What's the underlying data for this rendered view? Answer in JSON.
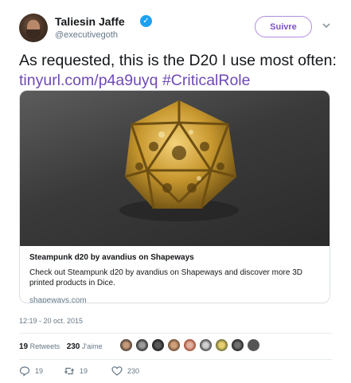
{
  "tweet": {
    "author_name": "Taliesin Jaffe",
    "handle": "@executivegoth",
    "follow_label": "Suivre",
    "text": "As requested, this is the D20 I use most often:",
    "link": "tinyurl.com/p4a9uyq",
    "hashtag": "#CriticalRole",
    "timestamp": "12:19 - 20 oct. 2015"
  },
  "card": {
    "title": "Steampunk d20 by avandius on Shapeways",
    "description": "Check out Steampunk d20 by avandius on Shapeways and discover more 3D printed products in Dice.",
    "domain": "shapeways.com"
  },
  "stats": {
    "retweets_count": "19",
    "retweets_label": "Retweets",
    "likes_count": "230",
    "likes_label": "J'aime"
  },
  "actions": {
    "reply_count": "19",
    "retweet_count": "19",
    "like_count": "230"
  },
  "icons": [
    "verified-badge-icon",
    "chevron-down-icon",
    "reply-icon",
    "retweet-icon",
    "heart-icon"
  ],
  "colors": {
    "verified": "#1da1f2",
    "link": "#6f49b8",
    "follow_border": "#b08be0",
    "muted": "#657786"
  }
}
